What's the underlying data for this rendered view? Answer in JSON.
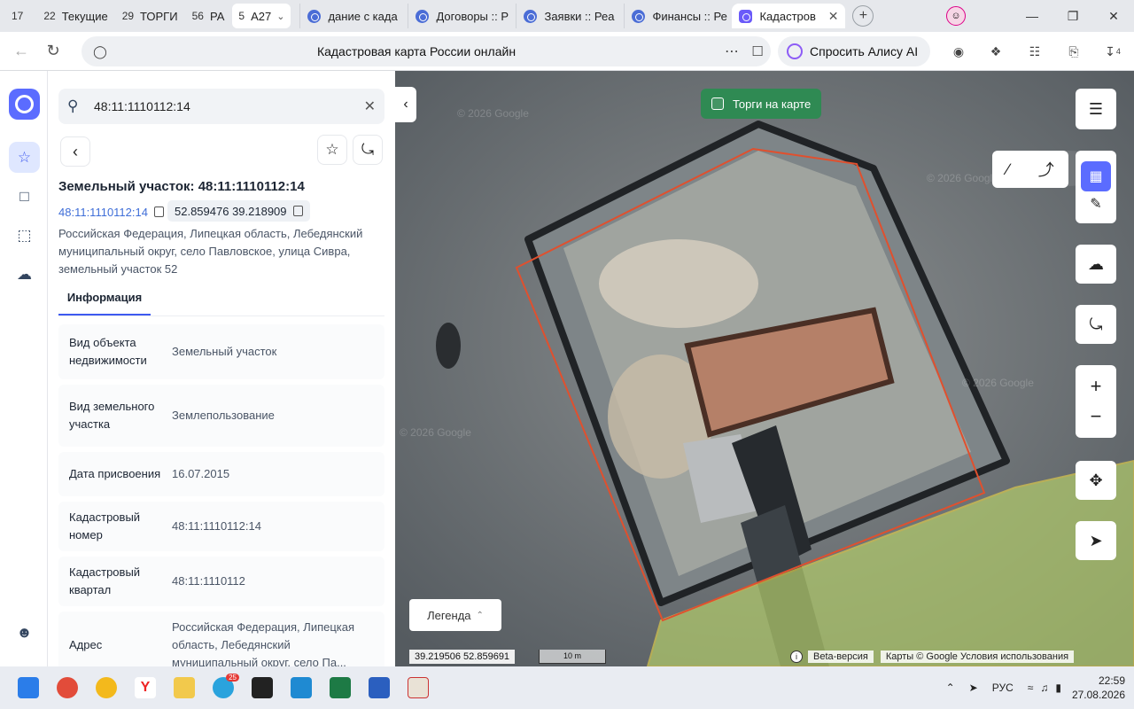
{
  "browser": {
    "group_tabs": [
      {
        "count": "17",
        "label": ""
      },
      {
        "count": "22",
        "label": "Текущие"
      },
      {
        "count": "29",
        "label": "ТОРГИ"
      },
      {
        "count": "56",
        "label": "РА"
      },
      {
        "count": "5",
        "label": "А27"
      }
    ],
    "page_tabs": [
      {
        "title": "дание с када"
      },
      {
        "title": "Договоры :: Р"
      },
      {
        "title": "Заявки :: Реа"
      },
      {
        "title": "Финансы :: Ре"
      }
    ],
    "current_tab": {
      "title": "Кадастров"
    },
    "page_title": "Кадастровая карта России онлайн",
    "alice_label": "Спросить Алису AI",
    "download_count": "4"
  },
  "search": {
    "query": "48:11:1110112:14"
  },
  "object": {
    "title": "Земельный участок: 48:11:1110112:14",
    "cad_link": "48:11:1110112:14",
    "coords": "52.859476 39.218909",
    "address": "Российская Федерация, Липецкая область, Лебедянский муниципальный округ, село Павловское, улица Сивра, земельный участок 52",
    "tab_label": "Информация",
    "rows": [
      {
        "k": "Вид объекта недвижимости",
        "v": "Земельный участок"
      },
      {
        "k": "Вид земельного участка",
        "v": "Землепользование"
      },
      {
        "k": "Дата присвоения",
        "v": "16.07.2015"
      },
      {
        "k": "Кадастровый номер",
        "v": "48:11:1110112:14"
      },
      {
        "k": "Кадастровый квартал",
        "v": "48:11:1110112"
      },
      {
        "k": "Адрес",
        "v": "Российская Федерация, Липецкая область, Лебедянский муниципальный округ, село Па..."
      }
    ]
  },
  "map": {
    "torgi_label": "Торги на карте",
    "legend_label": "Легенда",
    "cursor_coords": "39.219506   52.859691",
    "scale_label": "10 m",
    "beta_label": "Beta-версия",
    "attribution": "Карты © Google   Условия использования",
    "colors": {
      "parcel_outline": "#e0502e",
      "neighbor_fill": "#b9d46b",
      "neighbor_outline": "#e6d24a",
      "accent": "#3e5af0",
      "torgi_bg": "#2f8a53"
    }
  },
  "taskbar": {
    "telegram_badge": "25",
    "lang": "РУС",
    "time": "22:59",
    "date": "27.08.2026"
  }
}
